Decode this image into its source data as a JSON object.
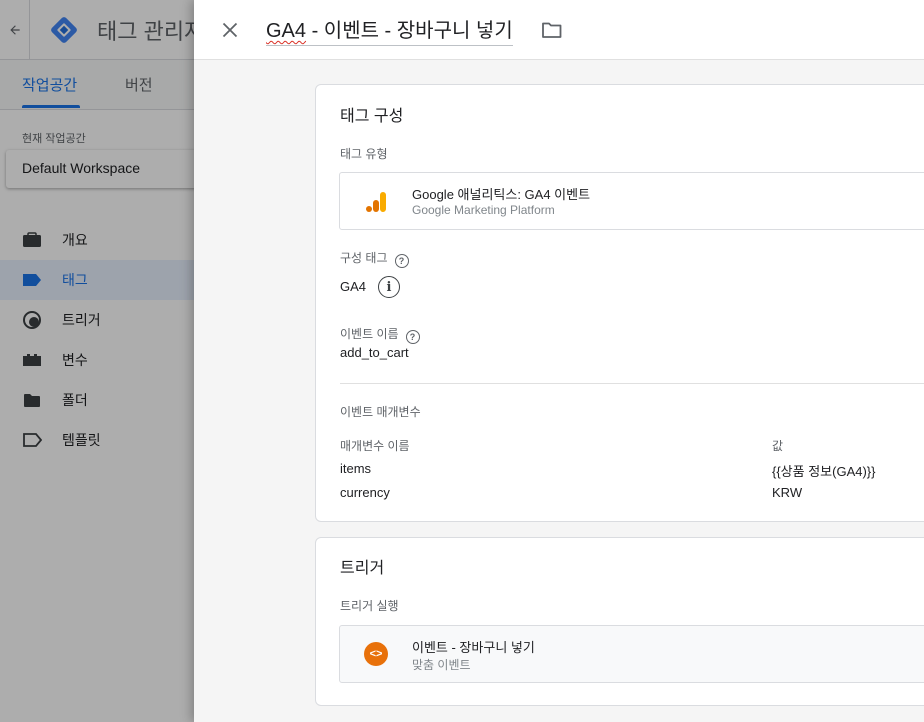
{
  "background_app": {
    "app_title": "태그 관리자",
    "tabs": [
      {
        "label": "작업공간",
        "active": true
      },
      {
        "label": "버전",
        "active": false
      }
    ],
    "workspace_label": "현재 작업공간",
    "workspace_name": "Default Workspace",
    "nav_items": [
      {
        "label": "개요",
        "icon": "briefcase-icon",
        "active": false
      },
      {
        "label": "태그",
        "icon": "tag-icon",
        "active": true
      },
      {
        "label": "트리거",
        "icon": "trigger-icon",
        "active": false
      },
      {
        "label": "변수",
        "icon": "variable-icon",
        "active": false
      },
      {
        "label": "폴더",
        "icon": "folder-icon",
        "active": false
      },
      {
        "label": "템플릿",
        "icon": "template-icon",
        "active": false
      }
    ]
  },
  "panel": {
    "tag_name_prefix": "GA4",
    "tag_name_rest": " - 이벤트 - 장바구니 넣기",
    "tag_config": {
      "title": "태그 구성",
      "tag_type_label": "태그 유형",
      "tag_type_name": "Google 애널리틱스: GA4 이벤트",
      "tag_type_platform": "Google Marketing Platform",
      "config_tag_label": "구성 태그",
      "config_tag_value": "GA4",
      "event_name_label": "이벤트 이름",
      "event_name_value": "add_to_cart",
      "event_params_label": "이벤트 매개변수",
      "param_name_header": "매개변수 이름",
      "param_value_header": "값",
      "params": [
        {
          "name": "items",
          "value": "{{상품 정보(GA4)}}"
        },
        {
          "name": "currency",
          "value": "KRW"
        }
      ]
    },
    "trigger": {
      "title": "트리거",
      "firing_label": "트리거 실행",
      "trigger_name": "이벤트 - 장바구니 넣기",
      "trigger_type": "맞춤 이벤트"
    }
  },
  "colors": {
    "accent": "#1a73e8",
    "analytics_orange": "#f9ab00",
    "custom_event_orange": "#e8710a"
  }
}
